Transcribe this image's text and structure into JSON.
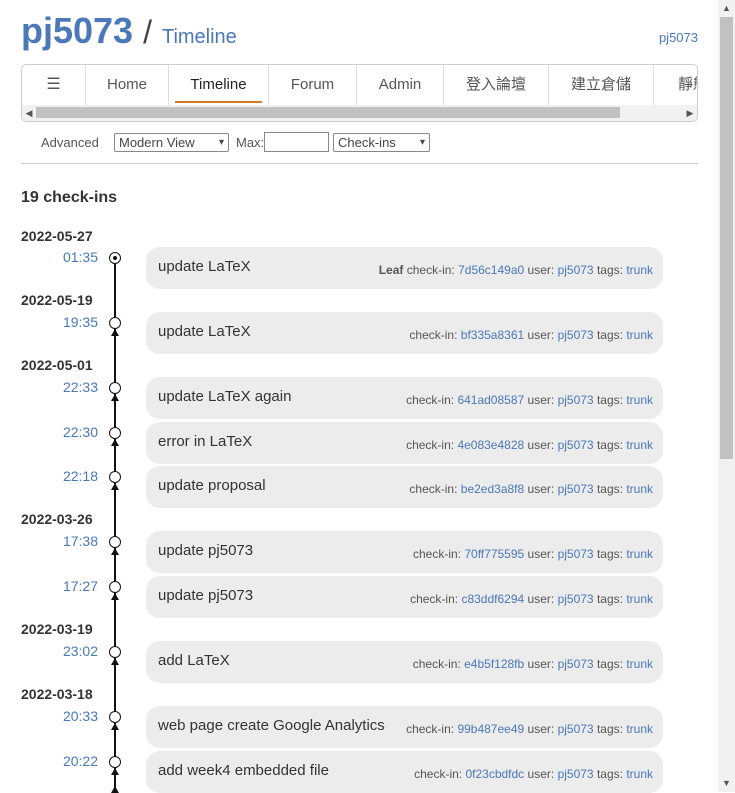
{
  "header": {
    "project": "pj5073",
    "slash": "/",
    "subtitle": "Timeline",
    "login": "pj5073"
  },
  "menu": {
    "hamburger": "☰",
    "items": [
      "Home",
      "Timeline",
      "Forum",
      "Admin",
      "登入論壇",
      "建立倉儲",
      "靜態"
    ],
    "current": "Timeline"
  },
  "submenu": {
    "advanced": "Advanced",
    "view_select": "Modern View",
    "max_label": "Max:",
    "max_value": "",
    "type_select": "Check-ins"
  },
  "timeline": {
    "count": "19 check-ins",
    "labels": {
      "leaf": "Leaf",
      "checkin": "check-in:",
      "user": "user:",
      "tags": "tags:"
    },
    "days": [
      "2022-05-27",
      "2022-05-19",
      "2022-05-01",
      "2022-03-26",
      "2022-03-19",
      "2022-03-18"
    ],
    "entries": [
      {
        "time": "01:35",
        "message": "update LaTeX",
        "leaf": true,
        "hash": "7d56c149a0",
        "user": "pj5073",
        "tag": "trunk"
      },
      {
        "time": "19:35",
        "message": "update LaTeX",
        "leaf": false,
        "hash": "bf335a8361",
        "user": "pj5073",
        "tag": "trunk"
      },
      {
        "time": "22:33",
        "message": "update LaTeX again",
        "leaf": false,
        "hash": "641ad08587",
        "user": "pj5073",
        "tag": "trunk"
      },
      {
        "time": "22:30",
        "message": "error in LaTeX",
        "leaf": false,
        "hash": "4e083e4828",
        "user": "pj5073",
        "tag": "trunk"
      },
      {
        "time": "22:18",
        "message": "update proposal",
        "leaf": false,
        "hash": "be2ed3a8f8",
        "user": "pj5073",
        "tag": "trunk"
      },
      {
        "time": "17:38",
        "message": "update pj5073",
        "leaf": false,
        "hash": "70ff775595",
        "user": "pj5073",
        "tag": "trunk"
      },
      {
        "time": "17:27",
        "message": "update pj5073",
        "leaf": false,
        "hash": "c83ddf6294",
        "user": "pj5073",
        "tag": "trunk"
      },
      {
        "time": "23:02",
        "message": "add LaTeX",
        "leaf": false,
        "hash": "e4b5f128fb",
        "user": "pj5073",
        "tag": "trunk"
      },
      {
        "time": "20:33",
        "message": "web page create Google Analytics",
        "leaf": false,
        "hash": "99b487ee49",
        "user": "pj5073",
        "tag": "trunk"
      },
      {
        "time": "20:22",
        "message": "add week4 embedded file",
        "leaf": false,
        "hash": "0f23cbdfdc",
        "user": "pj5073",
        "tag": "trunk"
      }
    ]
  },
  "icons": {
    "hamburger": "hamburger-icon",
    "scroll_left": "scroll-left-icon",
    "scroll_right": "scroll-right-icon",
    "scroll_up": "scroll-up-icon",
    "scroll_down": "scroll-down-icon"
  },
  "colors": {
    "link": "#4a78b8",
    "accent_underline": "#d07a2a",
    "bubble": "#ececec"
  }
}
